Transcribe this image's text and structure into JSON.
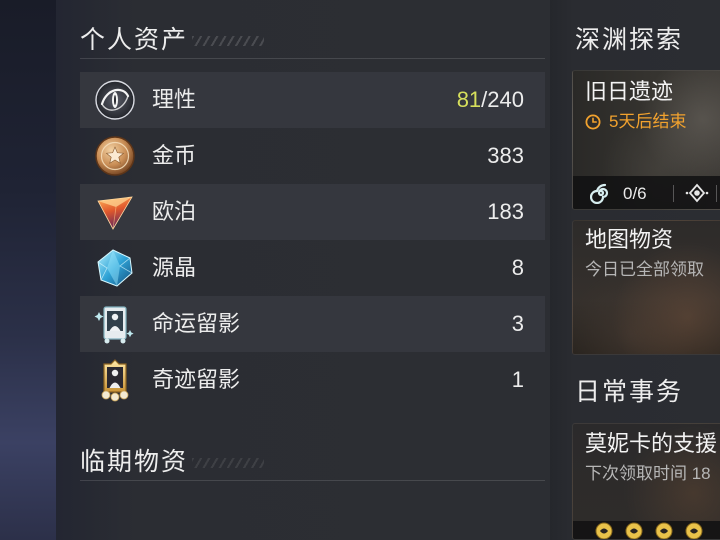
{
  "colors": {
    "panel_bg": "#2b2d33",
    "row_highlight": "#35373e",
    "text_primary": "#ececec",
    "sanity_current": "#d6df5c",
    "countdown": "#f2a22e",
    "muted_text": "#b6b6b6"
  },
  "assets": {
    "title": "个人资产",
    "items": [
      {
        "icon": "sanity-icon",
        "name": "理性",
        "highlight": "81",
        "value": "/240"
      },
      {
        "icon": "gold-coin-icon",
        "name": "金币",
        "value": "383"
      },
      {
        "icon": "opal-icon",
        "name": "欧泊",
        "value": "183"
      },
      {
        "icon": "source-crystal-icon",
        "name": "源晶",
        "value": "8"
      },
      {
        "icon": "fate-snapshot-icon",
        "name": "命运留影",
        "value": "3"
      },
      {
        "icon": "miracle-snapshot-icon",
        "name": "奇迹留影",
        "value": "1"
      }
    ]
  },
  "expiring": {
    "title": "临期物资"
  },
  "abyss": {
    "title": "深渊探索",
    "ruins": {
      "title": "旧日遗迹",
      "countdown_icon": "clock-icon",
      "countdown": "5天后结束",
      "progress_icon": "spiral-icon",
      "progress": "0/6",
      "extra_icon": "diamond-eye-icon"
    },
    "map_supplies": {
      "title": "地图物资",
      "status": "今日已全部领取"
    }
  },
  "daily": {
    "title": "日常事务",
    "support": {
      "title": "莫妮卡的支援",
      "status": "下次领取时间 18",
      "reward_icons": [
        "reward-token-icon",
        "reward-token-icon",
        "reward-token-icon",
        "reward-token-icon"
      ]
    }
  }
}
